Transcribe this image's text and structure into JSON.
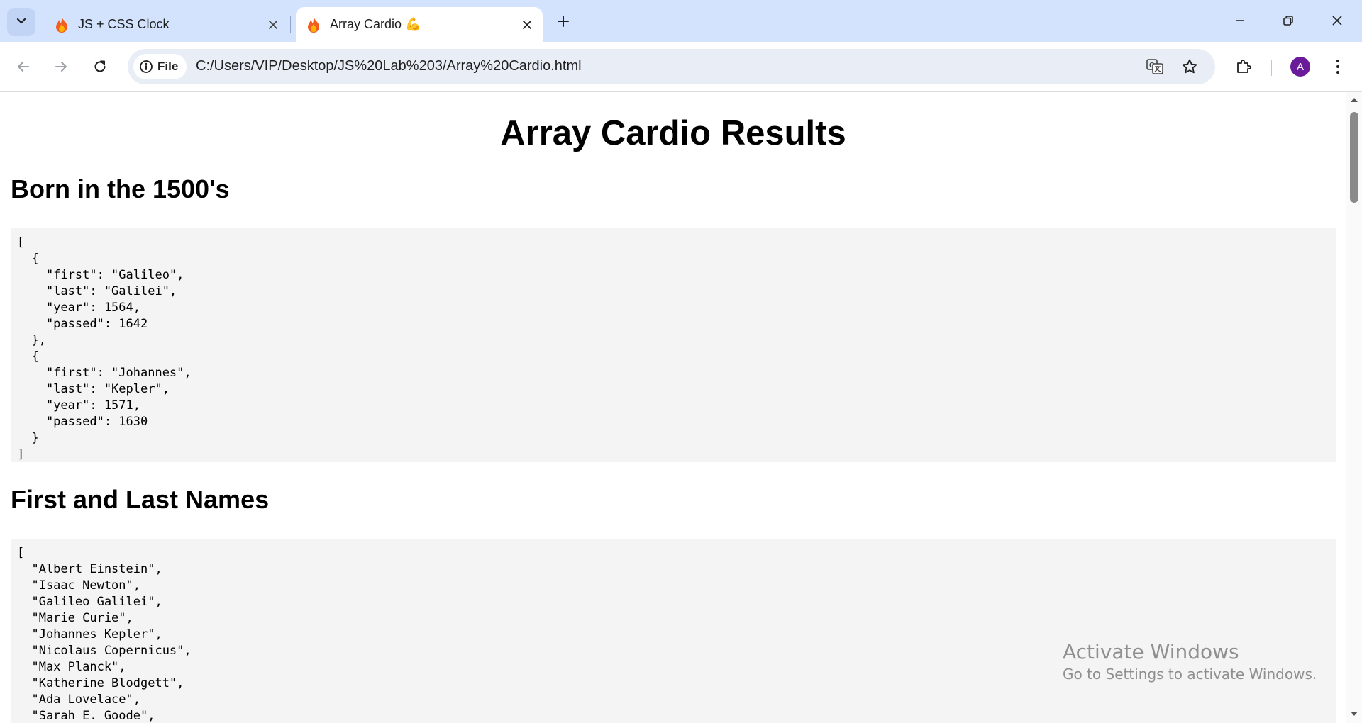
{
  "browser": {
    "tabs": [
      {
        "title": "JS + CSS Clock",
        "favicon": "fire-icon",
        "active": false
      },
      {
        "title": "Array Cardio 💪",
        "favicon": "fire-icon",
        "active": true
      }
    ],
    "address": {
      "chip_label": "File",
      "url": "C:/Users/VIP/Desktop/JS%20Lab%203/Array%20Cardio.html"
    },
    "profile_initial": "A"
  },
  "page": {
    "title": "Array Cardio Results",
    "sections": [
      {
        "heading": "Born in the 1500's",
        "code": "[\n  {\n    \"first\": \"Galileo\",\n    \"last\": \"Galilei\",\n    \"year\": 1564,\n    \"passed\": 1642\n  },\n  {\n    \"first\": \"Johannes\",\n    \"last\": \"Kepler\",\n    \"year\": 1571,\n    \"passed\": 1630\n  }\n]"
      },
      {
        "heading": "First and Last Names",
        "code": "[\n  \"Albert Einstein\",\n  \"Isaac Newton\",\n  \"Galileo Galilei\",\n  \"Marie Curie\",\n  \"Johannes Kepler\",\n  \"Nicolaus Copernicus\",\n  \"Max Planck\",\n  \"Katherine Blodgett\",\n  \"Ada Lovelace\",\n  \"Sarah E. Goode\","
      }
    ]
  },
  "watermark": {
    "title": "Activate Windows",
    "subtitle": "Go to Settings to activate Windows."
  }
}
